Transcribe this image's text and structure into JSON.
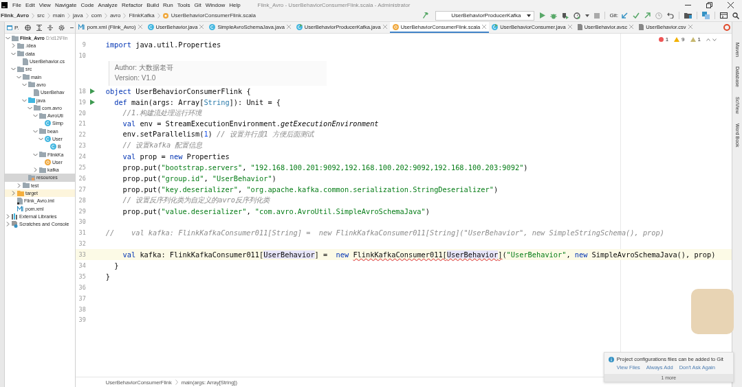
{
  "window": {
    "title": "Flink_Avro - UserBehaviorConsumerFlink.scala - Administrator"
  },
  "menu": [
    "File",
    "Edit",
    "View",
    "Navigate",
    "Code",
    "Analyze",
    "Refactor",
    "Build",
    "Run",
    "Tools",
    "Git",
    "Window",
    "Help"
  ],
  "breadcrumb": [
    "Flink_Avro",
    "src",
    "main",
    "java",
    "com",
    "avro",
    "FlinkKafka",
    "UserBehaviorConsumerFlink.scala"
  ],
  "toolbar": {
    "run_config": "UserBehaviorProducerKafka",
    "git_label": "Git:"
  },
  "project_panel": {
    "title": "P.",
    "tree": [
      {
        "label": "Flink_Avro",
        "path": "D:\\d12\\Flin",
        "kind": "project",
        "expanded": true,
        "selected": false,
        "children": [
          {
            "label": ".idea",
            "kind": "folder",
            "expanded": false,
            "selected": false
          },
          {
            "label": "data",
            "kind": "folder",
            "expanded": true,
            "selected": false,
            "children": [
              {
                "label": "UserBehavior.cs",
                "kind": "file",
                "selected": false
              }
            ]
          },
          {
            "label": "src",
            "kind": "folder",
            "expanded": true,
            "selected": false,
            "children": [
              {
                "label": "main",
                "kind": "folder",
                "expanded": true,
                "selected": false,
                "children": [
                  {
                    "label": "avro",
                    "kind": "folder",
                    "expanded": true,
                    "selected": false,
                    "children": [
                      {
                        "label": "UserBehav",
                        "kind": "file",
                        "selected": false
                      }
                    ]
                  },
                  {
                    "label": "java",
                    "kind": "source",
                    "expanded": true,
                    "selected": false,
                    "children": [
                      {
                        "label": "com.avro",
                        "kind": "package",
                        "expanded": true,
                        "selected": false,
                        "children": [
                          {
                            "label": "AvroUti",
                            "kind": "package",
                            "expanded": true,
                            "selected": false,
                            "children": [
                              {
                                "label": "Simp",
                                "kind": "class",
                                "selected": false
                              }
                            ]
                          },
                          {
                            "label": "bean",
                            "kind": "package",
                            "expanded": true,
                            "selected": false,
                            "children": [
                              {
                                "label": "User",
                                "kind": "class",
                                "expanded": true,
                                "selected": false,
                                "children": [
                                  {
                                    "label": "B",
                                    "kind": "class",
                                    "selected": false
                                  }
                                ]
                              }
                            ]
                          },
                          {
                            "label": "FlinkKa",
                            "kind": "package",
                            "expanded": true,
                            "selected": false,
                            "children": [
                              {
                                "label": "User",
                                "kind": "object",
                                "selected": false
                              }
                            ]
                          },
                          {
                            "label": "kafka",
                            "kind": "package",
                            "expanded": false,
                            "selected": false
                          }
                        ]
                      }
                    ]
                  },
                  {
                    "label": "resources",
                    "kind": "resources",
                    "selected": true
                  }
                ]
              },
              {
                "label": "test",
                "kind": "folder",
                "expanded": false,
                "selected": false
              }
            ]
          },
          {
            "label": "target",
            "kind": "excluded",
            "expanded": false,
            "selected": false
          },
          {
            "label": "Flink_Avro.iml",
            "kind": "iml",
            "selected": false
          },
          {
            "label": "pom.xml",
            "kind": "pom",
            "selected": false
          }
        ]
      },
      {
        "label": "External Libraries",
        "kind": "libs",
        "expanded": false,
        "selected": false
      },
      {
        "label": "Scratches and Console",
        "kind": "scratch",
        "expanded": false,
        "selected": false
      }
    ]
  },
  "tabs": [
    {
      "label": "pom.xml (Flink_Avro)",
      "kind": "pom",
      "selected": false
    },
    {
      "label": "UserBehavior.java",
      "kind": "class",
      "selected": false
    },
    {
      "label": "SimpleAvroSchemaJava.java",
      "kind": "class",
      "selected": false
    },
    {
      "label": "UserBehaviorProducerKafka.java",
      "kind": "runnable",
      "selected": false
    },
    {
      "label": "UserBehaviorConsumerFlink.scala",
      "kind": "object",
      "selected": true
    },
    {
      "label": "UserBehaviorConsumer.java",
      "kind": "runnable",
      "selected": false
    },
    {
      "label": "UserBehavior.avsc",
      "kind": "file",
      "selected": false
    },
    {
      "label": "UserBehavior.csv",
      "kind": "file",
      "selected": false
    }
  ],
  "inspections": [
    {
      "kind": "error",
      "count": "1"
    },
    {
      "kind": "warning",
      "count": "9"
    },
    {
      "kind": "weak",
      "count": "1"
    }
  ],
  "editor": {
    "lines": [
      {
        "kind": "code",
        "n": "9",
        "segs": [
          {
            "kind": "keyword",
            "t": "import"
          },
          {
            "kind": "plain",
            "t": " java.util.Properties"
          }
        ]
      },
      {
        "kind": "code",
        "n": "10"
      },
      {
        "kind": "doc",
        "rows": [
          "Author: 大数据老哥",
          "Version: V1.0"
        ]
      },
      {
        "kind": "code",
        "n": "18",
        "run": true,
        "segs": [
          {
            "kind": "keyword",
            "t": "object"
          },
          {
            "kind": "plain",
            "t": " UserBehaviorConsumerFlink {"
          }
        ]
      },
      {
        "kind": "code",
        "n": "19",
        "run": true,
        "segs": [
          {
            "kind": "keyword",
            "t": "  def"
          },
          {
            "kind": "plain",
            "t": " main(args: Array["
          },
          {
            "kind": "type",
            "t": "String"
          },
          {
            "kind": "plain",
            "t": "]): Unit = {"
          }
        ]
      },
      {
        "kind": "code",
        "n": "20",
        "segs": [
          {
            "kind": "comment",
            "t": "    //1.构建流处理运行环境"
          }
        ]
      },
      {
        "kind": "code",
        "n": "21",
        "segs": [
          {
            "kind": "keyword",
            "t": "    val"
          },
          {
            "kind": "plain",
            "t": " env = StreamExecutionEnvironment."
          },
          {
            "kind": "italic",
            "t": "getExecutionEnvironment"
          }
        ]
      },
      {
        "kind": "code",
        "n": "22",
        "segs": [
          {
            "kind": "plain",
            "t": "    env.setParallelism("
          },
          {
            "kind": "number",
            "t": "1"
          },
          {
            "kind": "plain",
            "t": ") "
          },
          {
            "kind": "comment",
            "t": "// 设置并行度1 方便后面测试"
          }
        ]
      },
      {
        "kind": "code",
        "n": "23",
        "segs": [
          {
            "kind": "comment",
            "t": "    // 设置kafka 配置信息"
          }
        ]
      },
      {
        "kind": "code",
        "n": "24",
        "segs": [
          {
            "kind": "keyword",
            "t": "    val"
          },
          {
            "kind": "plain",
            "t": " prop = "
          },
          {
            "kind": "keyword",
            "t": "new"
          },
          {
            "kind": "plain",
            "t": " Properties"
          }
        ]
      },
      {
        "kind": "code",
        "n": "25",
        "segs": [
          {
            "kind": "plain",
            "t": "    prop.put("
          },
          {
            "kind": "string",
            "t": "\"bootstrap.servers\""
          },
          {
            "kind": "plain",
            "t": ", "
          },
          {
            "kind": "string",
            "t": "\"192.168.100.201:9092,192.168.100.202:9092,192.168.100.203:9092\""
          },
          {
            "kind": "plain",
            "t": ")"
          }
        ]
      },
      {
        "kind": "code",
        "n": "26",
        "segs": [
          {
            "kind": "plain",
            "t": "    prop.put("
          },
          {
            "kind": "string",
            "t": "\"group.id\""
          },
          {
            "kind": "plain",
            "t": ", "
          },
          {
            "kind": "string",
            "t": "\"UserBehavior\""
          },
          {
            "kind": "plain",
            "t": ")"
          }
        ]
      },
      {
        "kind": "code",
        "n": "27",
        "segs": [
          {
            "kind": "plain",
            "t": "    prop.put("
          },
          {
            "kind": "string",
            "t": "\"key.deserializer\""
          },
          {
            "kind": "plain",
            "t": ", "
          },
          {
            "kind": "string",
            "t": "\"org.apache.kafka.common.serialization.StringDeserializer\""
          },
          {
            "kind": "plain",
            "t": ")"
          }
        ]
      },
      {
        "kind": "code",
        "n": "28",
        "segs": [
          {
            "kind": "comment",
            "t": "    // 设置反序列化类为自定义的avro反序列化类"
          }
        ]
      },
      {
        "kind": "code",
        "n": "29",
        "segs": [
          {
            "kind": "plain",
            "t": "    prop.put("
          },
          {
            "kind": "string",
            "t": "\"value.deserializer\""
          },
          {
            "kind": "plain",
            "t": ", "
          },
          {
            "kind": "string",
            "t": "\"com.avro.AvroUtil.SimpleAvroSchemaJava\""
          },
          {
            "kind": "plain",
            "t": ")"
          }
        ]
      },
      {
        "kind": "code",
        "n": "30"
      },
      {
        "kind": "code",
        "n": "31",
        "segs": [
          {
            "kind": "comment",
            "t": "//    val kafka: FlinkKafkaConsumer011[String] =  new FlinkKafkaConsumer011[String](\"UserBehavior\", new SimpleStringSchema(), prop)"
          }
        ]
      },
      {
        "kind": "code",
        "n": "32"
      },
      {
        "kind": "code",
        "n": "33",
        "current": true,
        "segs": [
          {
            "kind": "keyword",
            "t": "    val"
          },
          {
            "kind": "plain",
            "t": " kafka: FlinkKafkaConsumer011["
          },
          {
            "kind": "reference",
            "t": "UserBehavior"
          },
          {
            "kind": "plain",
            "t": "] =  "
          },
          {
            "kind": "keyword",
            "t": "new "
          },
          {
            "kind": "error",
            "t": "FlinkKafkaConsumer011["
          },
          {
            "kind": "error-reference",
            "t": "UserBehavior"
          },
          {
            "kind": "error",
            "t": "]"
          },
          {
            "kind": "plain",
            "t": "("
          },
          {
            "kind": "string",
            "t": "\"UserBehavior\""
          },
          {
            "kind": "plain",
            "t": ", "
          },
          {
            "kind": "keyword",
            "t": "new"
          },
          {
            "kind": "plain",
            "t": " SimpleAvroSchemaJava(), prop)"
          }
        ]
      },
      {
        "kind": "code",
        "n": "34",
        "segs": [
          {
            "kind": "plain",
            "t": "  }"
          }
        ]
      },
      {
        "kind": "code",
        "n": "35",
        "segs": [
          {
            "kind": "plain",
            "t": "}"
          }
        ]
      },
      {
        "kind": "code",
        "n": "36"
      },
      {
        "kind": "code",
        "n": "37"
      },
      {
        "kind": "code",
        "n": "38"
      },
      {
        "kind": "code",
        "n": "39"
      }
    ]
  },
  "editor_breadcrumb": [
    "UserBehaviorConsumerFlink",
    "main(args: Array[String])"
  ],
  "right_strip": [
    "Maven",
    "Database",
    "SciView",
    "Word Book"
  ],
  "notification": {
    "message": "Project configurations files can be added to Git",
    "actions": [
      "View Files",
      "Always Add",
      "Don't Ask Again"
    ],
    "more": "1 more"
  }
}
